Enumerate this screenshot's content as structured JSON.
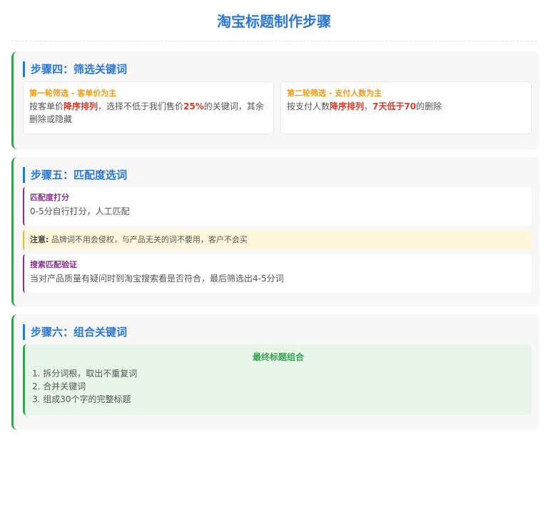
{
  "title": "淘宝标题制作步骤",
  "step4": {
    "heading": "步骤四：筛选关键词",
    "card1": {
      "title": "第一轮筛选 - 客单价为主",
      "t1": "按客单价",
      "h1": "降序排列",
      "t2": "，选择不低于我们售价",
      "h2": "25%",
      "t3": "的关键词，其余删除或隐藏"
    },
    "card2": {
      "title": "第二轮筛选 - 支付人数为主",
      "t1": "按支付人数",
      "h1": "降序排列",
      "t2": "，",
      "h2": "7天低于70",
      "t3": "的删除"
    }
  },
  "step5": {
    "heading": "步骤五：匹配度选词",
    "card1": {
      "title": "匹配度打分",
      "text": "0-5分自行打分，人工匹配"
    },
    "note": {
      "label": "注意:",
      "text": " 品牌词不用会侵权，与产品无关的词不要用，客户不会买"
    },
    "card2": {
      "title": "搜索匹配验证",
      "text": "当对产品质量有疑问时到淘宝搜索看是否符合，最后筛选出4-5分词"
    }
  },
  "step6": {
    "heading": "步骤六：组合关键词",
    "final_title": "最终标题组合",
    "items": [
      "1. 拆分词根，取出不重复词",
      "2. 合并关键词",
      "3. 组成30个字的完整标题"
    ]
  },
  "colors": {
    "primary": "#2b77d4",
    "accent_green": "#3aa155",
    "highlight_red": "#d93a2b",
    "orange": "#f09a13",
    "purple": "#8a2f8f",
    "note_bg": "#fff7db"
  }
}
